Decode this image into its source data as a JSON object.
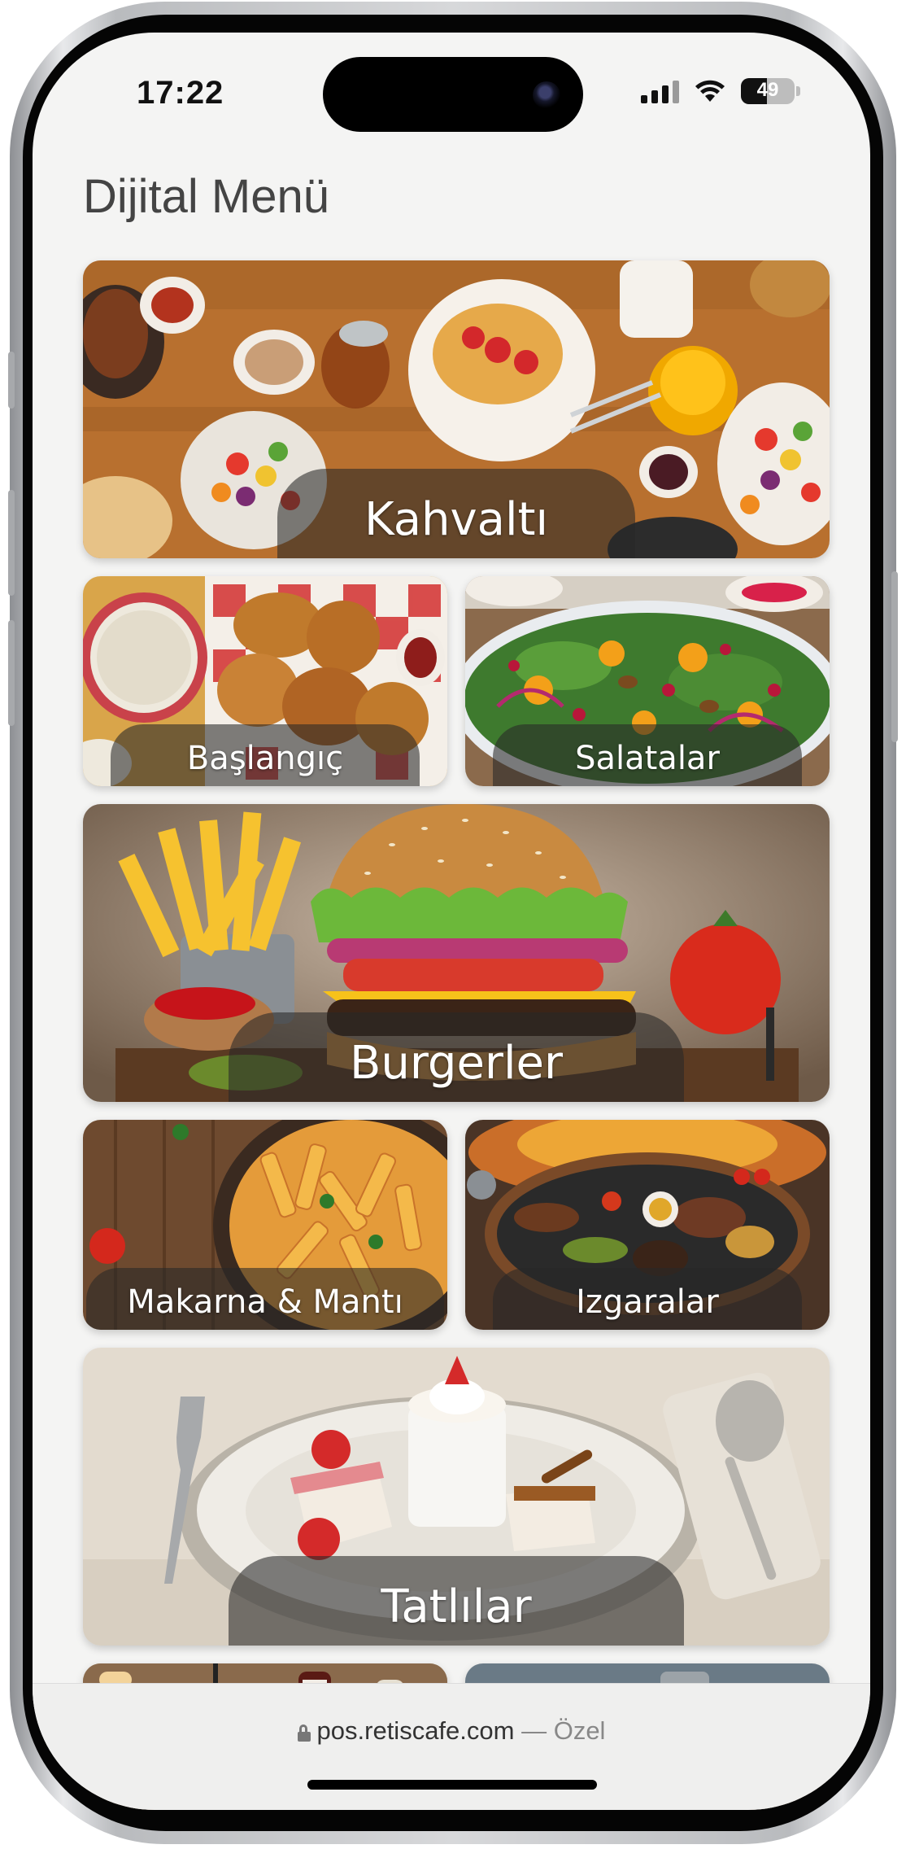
{
  "status_bar": {
    "time": "17:22",
    "battery": "49"
  },
  "page": {
    "title": "Dijital Menü"
  },
  "categories": [
    {
      "label": "Kahvaltı"
    },
    {
      "label": "Başlangıç"
    },
    {
      "label": "Salatalar"
    },
    {
      "label": "Burgerler"
    },
    {
      "label": "Makarna & Mantı"
    },
    {
      "label": "Izgaralar"
    },
    {
      "label": "Tatlılar"
    }
  ],
  "browser": {
    "domain": "pos.retiscafe.com",
    "mode": "— Özel"
  }
}
